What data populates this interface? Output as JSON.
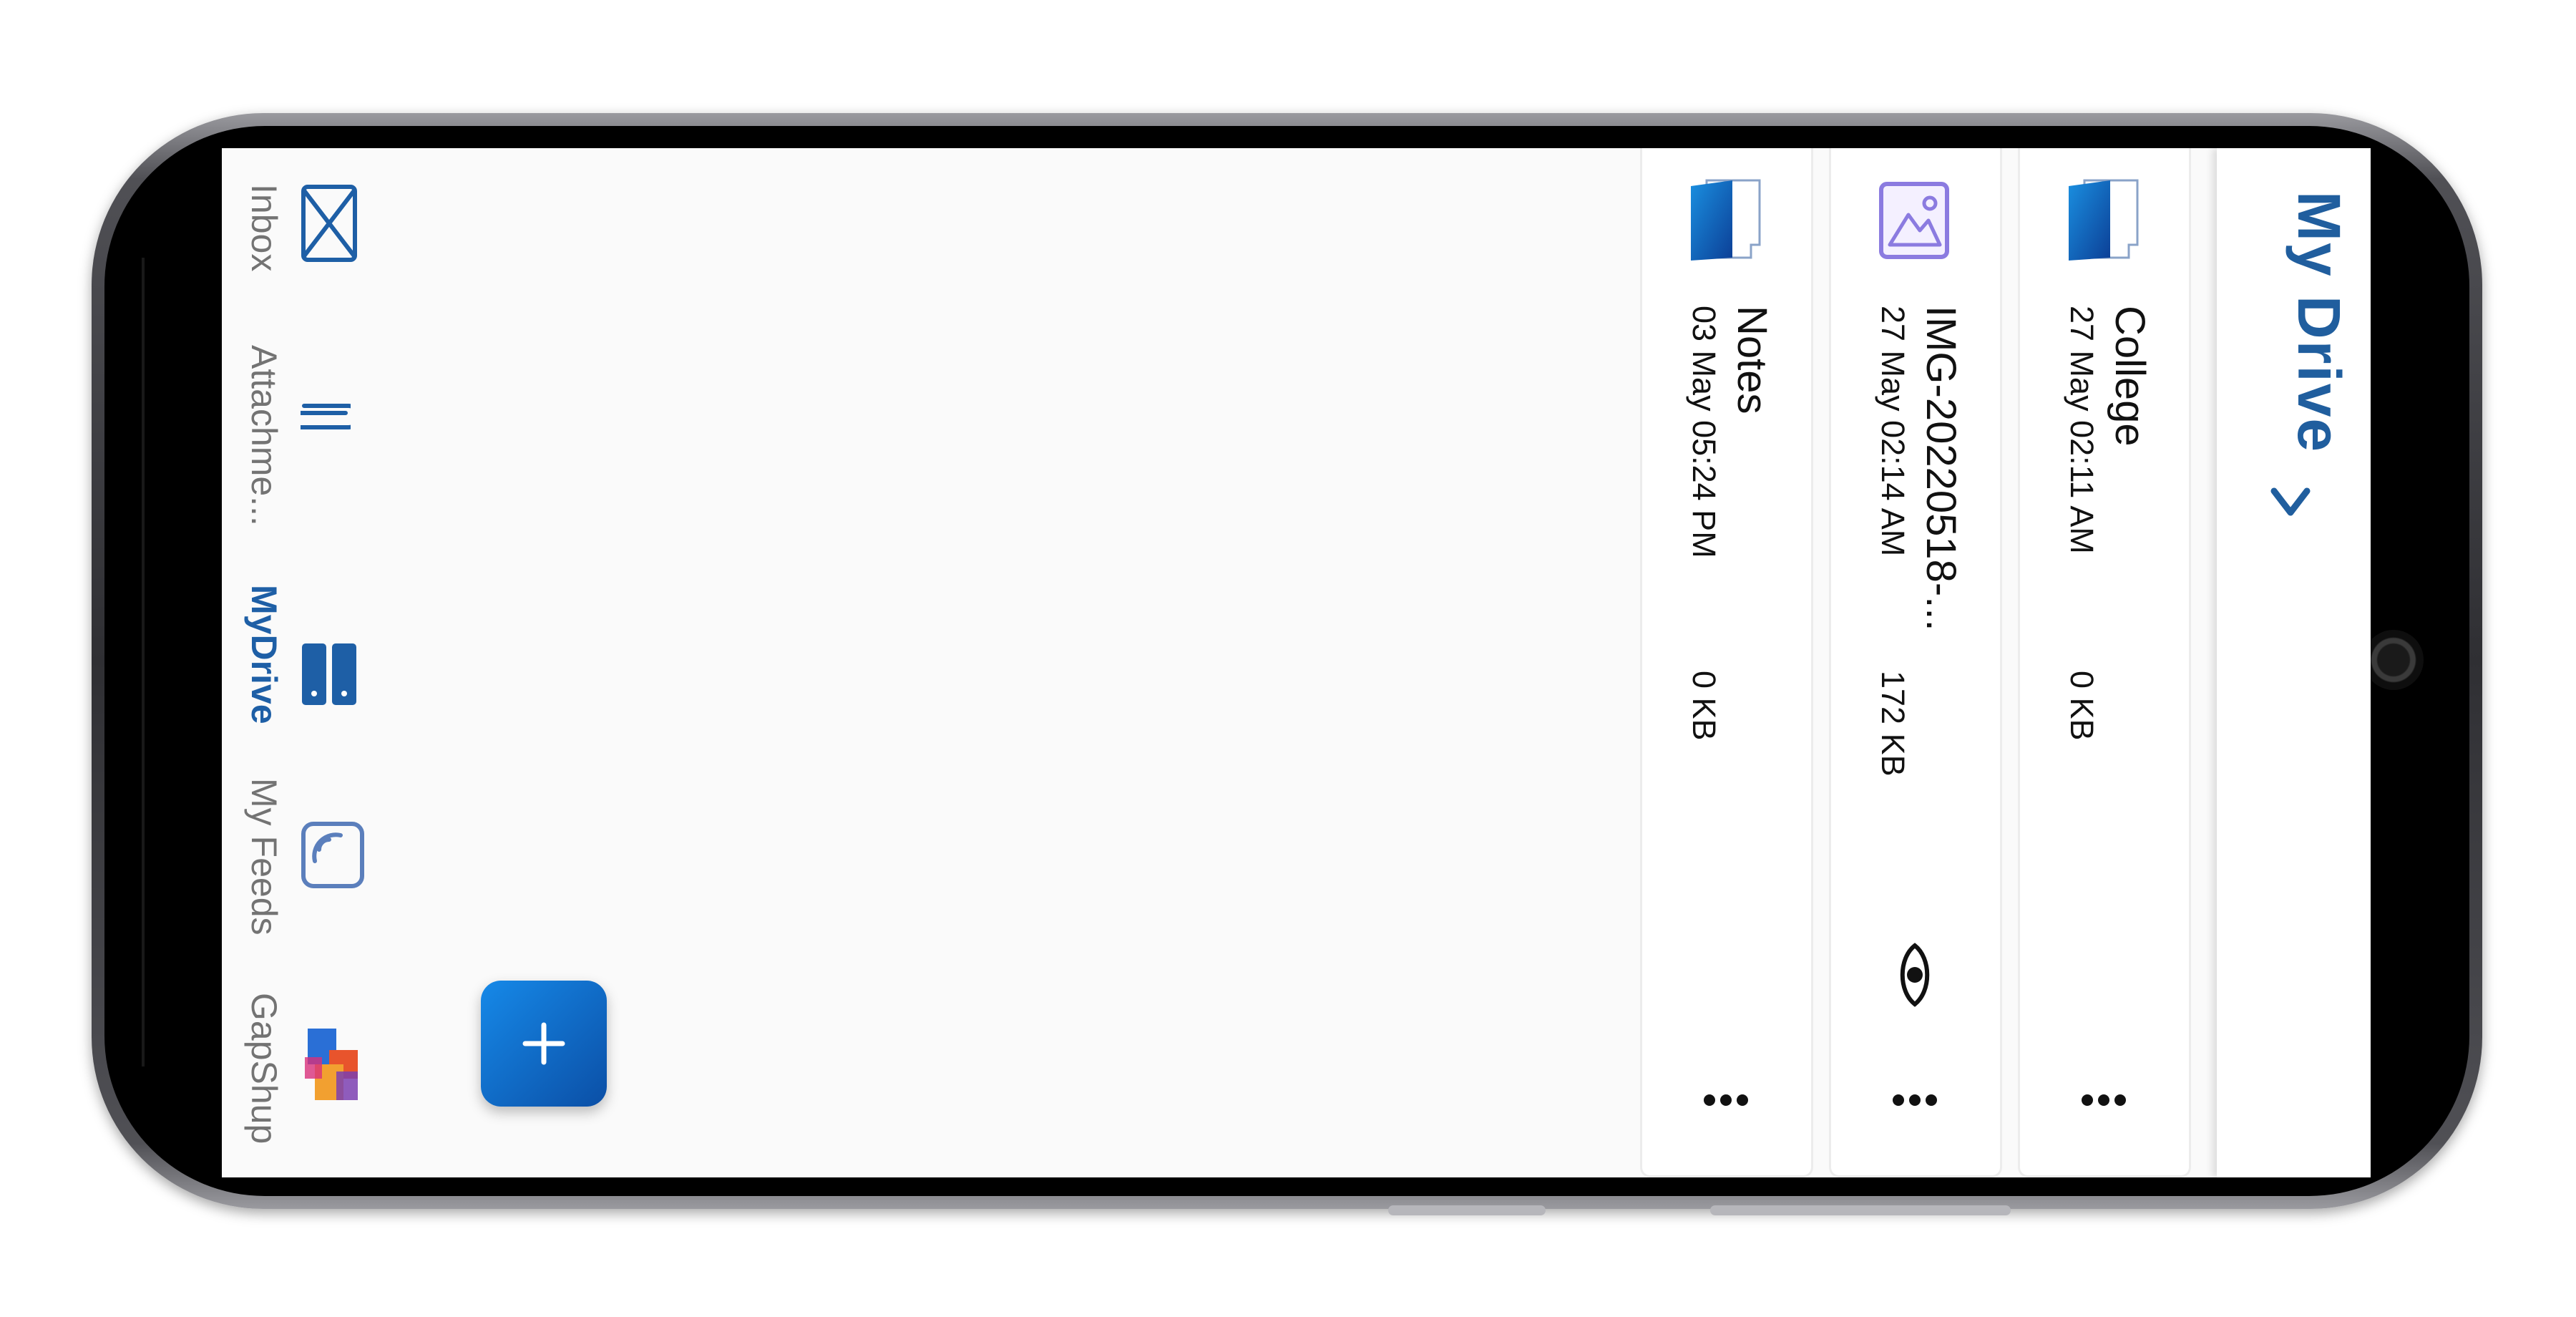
{
  "header": {
    "title": "My Drive",
    "chevron_icon": "chevron-right-icon"
  },
  "files": [
    {
      "name": "College",
      "date": "27 May 02:11 AM",
      "size": "0  KB",
      "icon": "folder-icon",
      "has_preview": false
    },
    {
      "name": "IMG-20220518-...",
      "date": "27 May 02:14 AM",
      "size": "172  KB",
      "icon": "image-file-icon",
      "has_preview": true
    },
    {
      "name": "Notes",
      "date": "03 May 05:24 PM",
      "size": "0  KB",
      "icon": "folder-icon",
      "has_preview": false
    }
  ],
  "nav": {
    "items": [
      {
        "label": "Inbox",
        "icon": "envelope-icon",
        "active": false
      },
      {
        "label": "Attachme...",
        "icon": "paperclip-icon",
        "active": false
      },
      {
        "label": "MyDrive",
        "icon": "drive-icon",
        "active": true
      },
      {
        "label": "My Feeds",
        "icon": "feed-icon",
        "active": false
      },
      {
        "label": "GapShup",
        "icon": "gapshup-icon",
        "active": false
      }
    ]
  },
  "fab": {
    "label": "+",
    "icon": "plus-icon"
  },
  "colors": {
    "accent": "#205e9e",
    "fab": "#1277d6",
    "inactive": "#737373"
  }
}
